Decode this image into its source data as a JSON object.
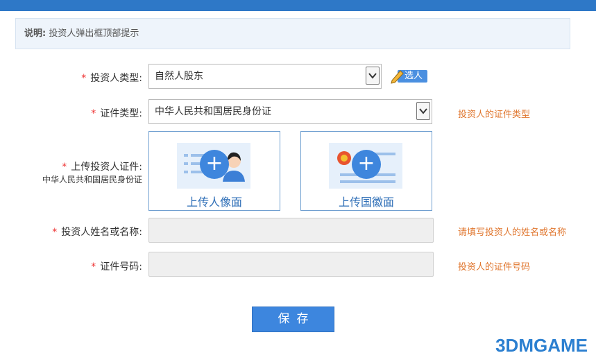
{
  "notice": {
    "label": "说明:",
    "text": "投资人弹出框顶部提示"
  },
  "investor_type": {
    "required": "*",
    "label": "投资人类型:",
    "value": "自然人股东",
    "pick_label": "选人"
  },
  "id_type": {
    "required": "*",
    "label": "证件类型:",
    "value": "中华人民共和国居民身份证",
    "hint": "投资人的证件类型"
  },
  "upload": {
    "required": "*",
    "label": "上传投资人证件:",
    "sublabel": "中华人民共和国居民身份证",
    "front_caption": "上传人像面",
    "back_caption": "上传国徽面",
    "plus": "+"
  },
  "name": {
    "required": "*",
    "label": "投资人姓名或名称:",
    "value": "",
    "hint": "请填写投资人的姓名或名称"
  },
  "id_number": {
    "required": "*",
    "label": "证件号码:",
    "value": "",
    "hint": "投资人的证件号码"
  },
  "save_label": "保存",
  "watermark": "3DMGAME",
  "colors": {
    "accent": "#3d86de",
    "topbar": "#2e78c7",
    "hint": "#e0762e",
    "required": "#e33333"
  }
}
